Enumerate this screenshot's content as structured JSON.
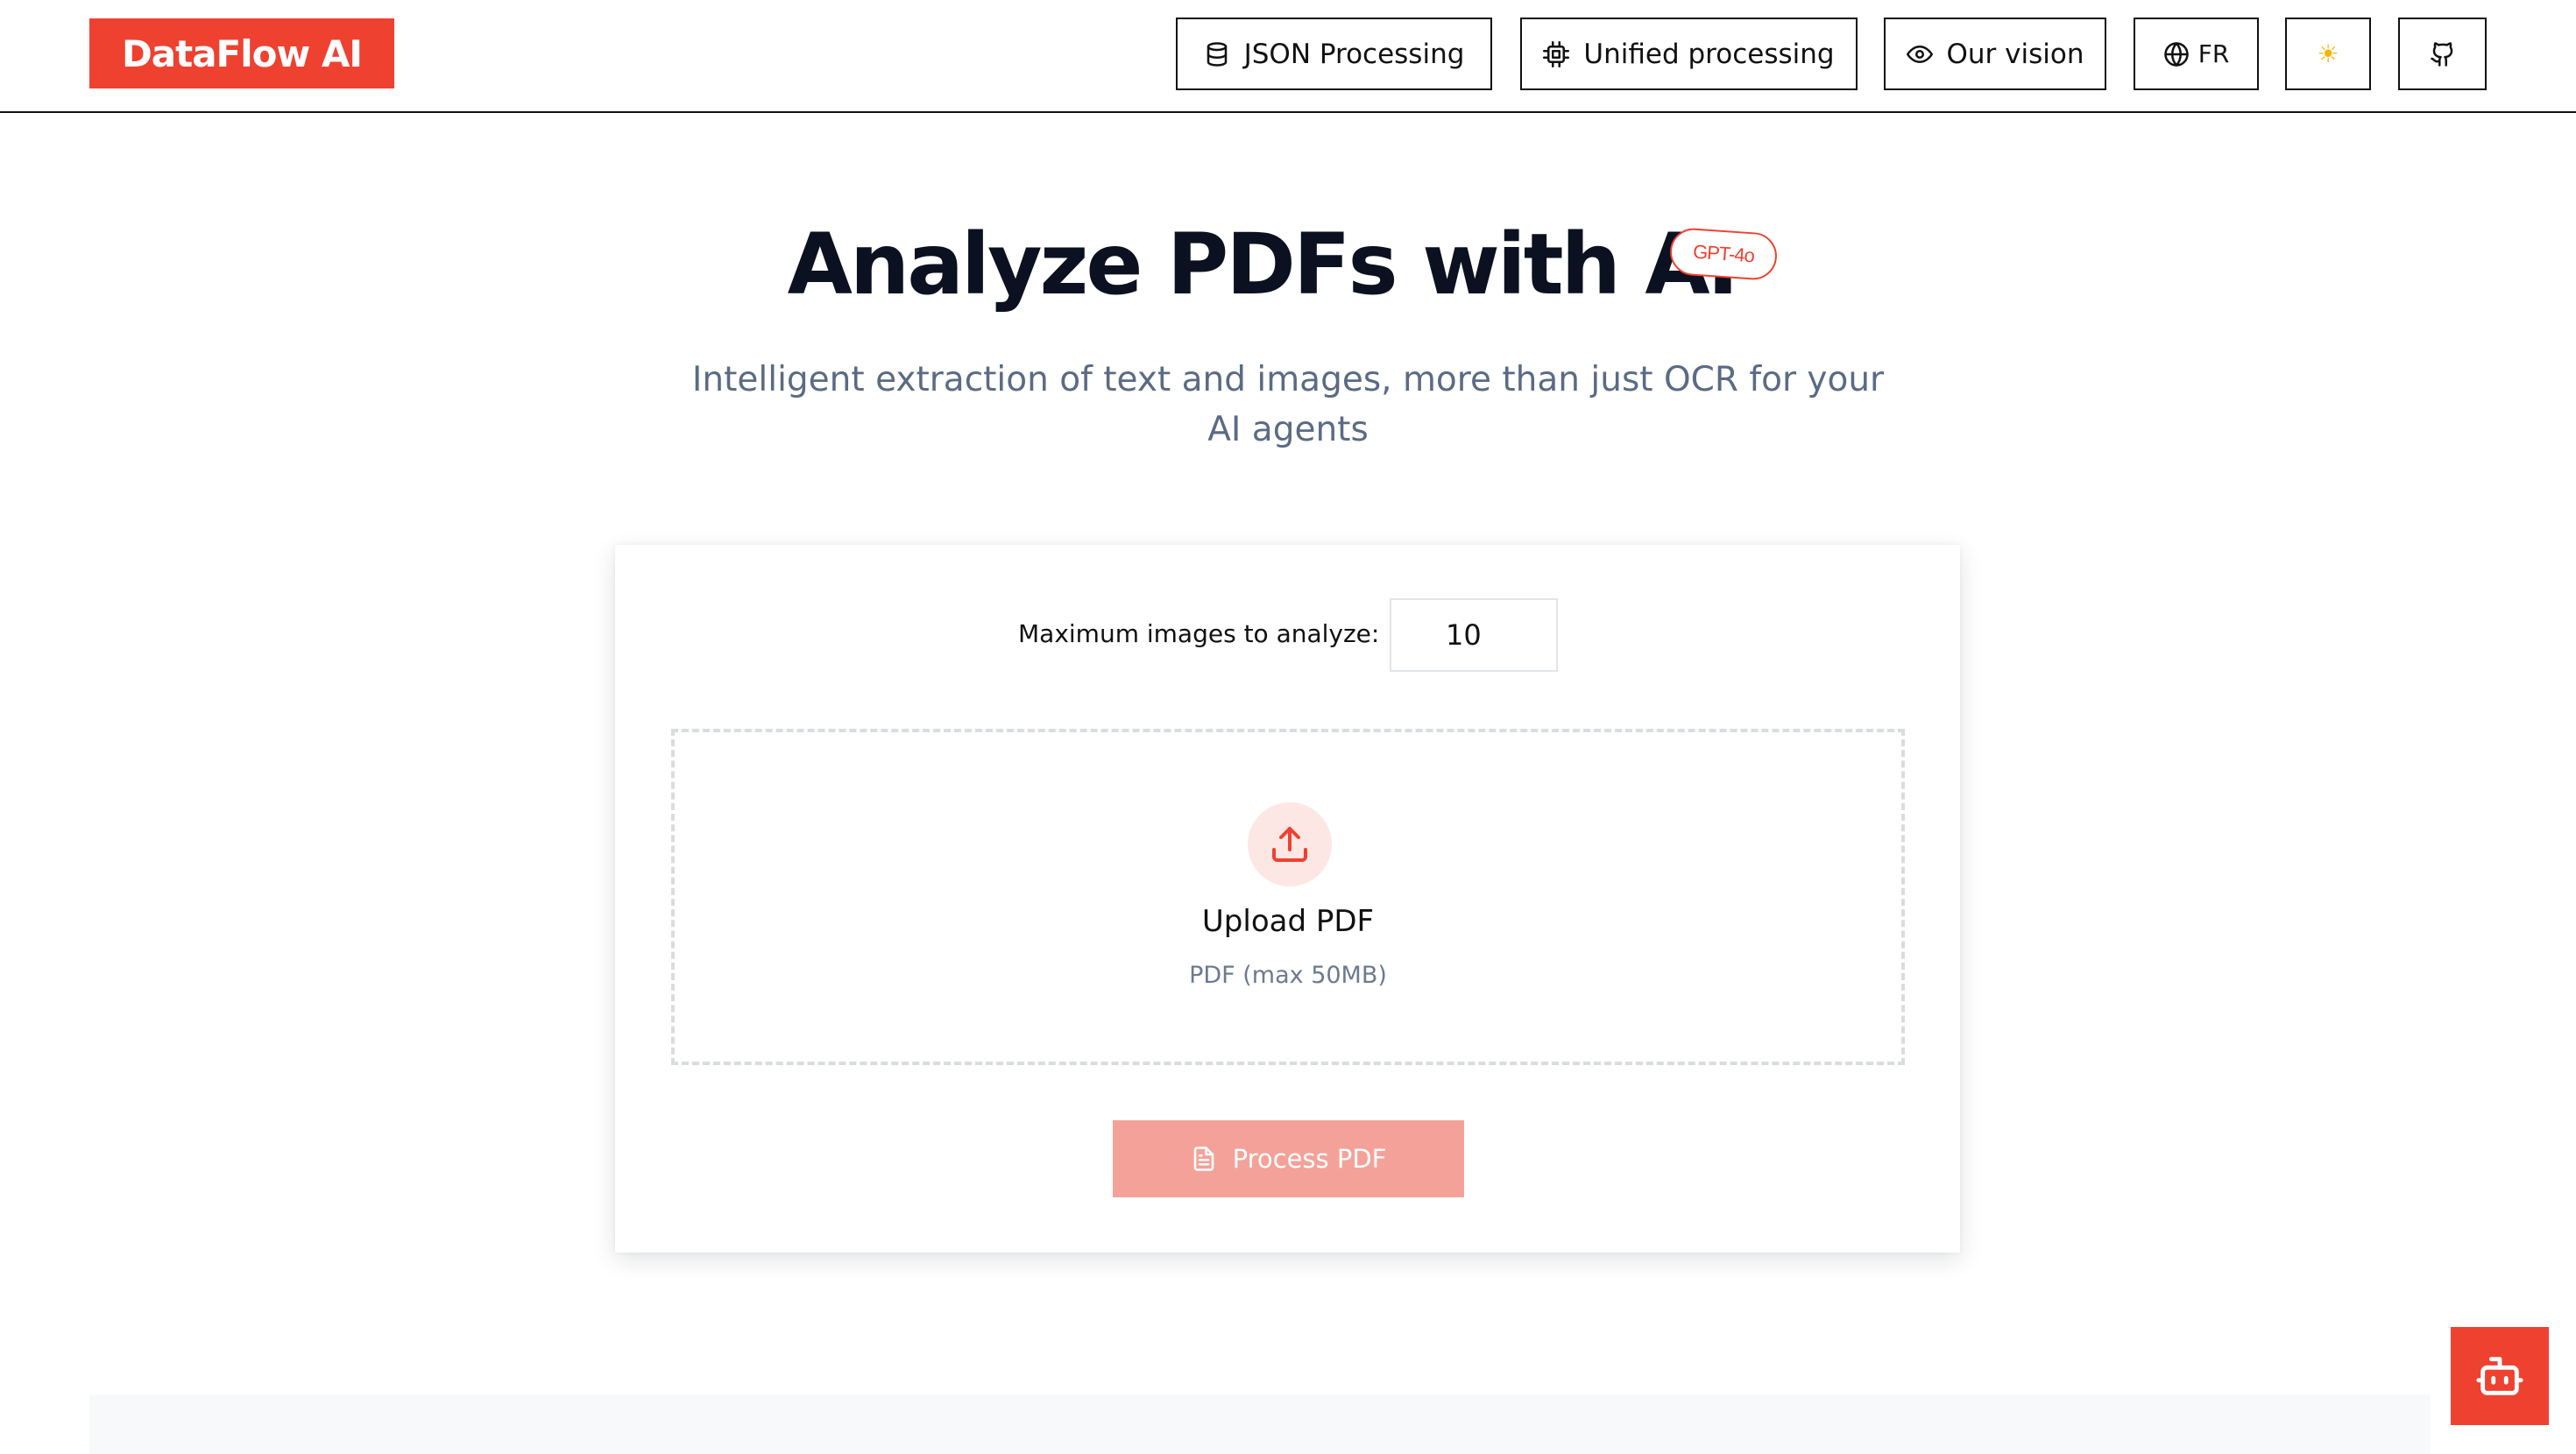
{
  "header": {
    "logo": "DataFlow AI",
    "nav": {
      "json_label": "JSON Processing",
      "unified_label": "Unified processing",
      "vision_label": "Our vision",
      "language_label": "FR",
      "theme_glyph": "☀",
      "icons": {
        "json": "database-icon",
        "unified": "cpu-chip-icon",
        "vision": "eye-icon",
        "language": "globe-icon",
        "theme": "sun-icon",
        "github": "github-icon"
      }
    }
  },
  "hero": {
    "title": "Analyze PDFs with AI",
    "badge": "GPT-4o",
    "subtitle": "Intelligent extraction of text and images, more than just OCR for your AI agents"
  },
  "form": {
    "max_images_label": "Maximum images to analyze:",
    "max_images_value": "10",
    "upload": {
      "icon": "upload-icon",
      "title": "Upload PDF",
      "hint": "PDF (max 50MB)"
    },
    "process_button": {
      "icon": "document-icon",
      "label": "Process PDF"
    }
  },
  "chat_fab": {
    "icon": "robot-icon"
  },
  "colors": {
    "accent": "#ef4130",
    "accent_disabled": "#f4a299",
    "accent_soft": "#fde7e4",
    "text_primary": "#0b1120",
    "text_muted": "#5b6b85",
    "border": "#111111"
  }
}
